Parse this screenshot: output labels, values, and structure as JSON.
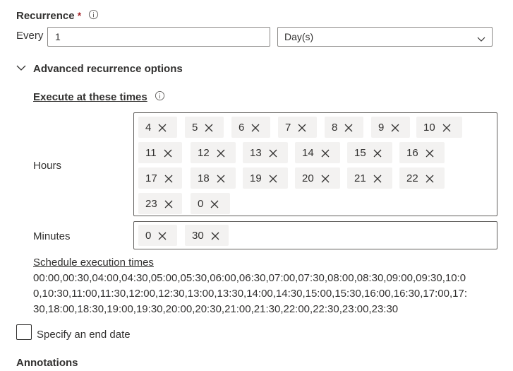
{
  "recurrence": {
    "label": "Recurrence",
    "required_mark": "*",
    "every_label": "Every",
    "every_value": "1",
    "unit_selected": "Day(s)"
  },
  "advanced": {
    "toggle_label": "Advanced recurrence options",
    "execute_label": "Execute at these times",
    "hours_label": "Hours",
    "hours": [
      "4",
      "5",
      "6",
      "7",
      "8",
      "9",
      "10",
      "11",
      "12",
      "13",
      "14",
      "15",
      "16",
      "17",
      "18",
      "19",
      "20",
      "21",
      "22",
      "23",
      "0"
    ],
    "minutes_label": "Minutes",
    "minutes": [
      "0",
      "30"
    ],
    "schedule_label": "Schedule execution times",
    "schedule_lines": [
      "00:00,00:30,04:00,04:30,05:00,05:30,06:00,06:30,07:00,07:30,08:00,08:30,09:00,09:30,10:0",
      "0,10:30,11:00,11:30,12:00,12:30,13:00,13:30,14:00,14:30,15:00,15:30,16:00,16:30,17:00,17:",
      "30,18:00,18:30,19:00,19:30,20:00,20:30,21:00,21:30,22:00,22:30,23:00,23:30"
    ]
  },
  "end_date": {
    "label": "Specify an end date",
    "checked": false
  },
  "annotations": {
    "label": "Annotations"
  },
  "icons": {
    "info": "info-icon",
    "chevron": "chevron-down-icon",
    "remove": "close-icon"
  },
  "colors": {
    "required": "#a4262c",
    "text": "#323130",
    "border": "#8a8886",
    "tag_bg": "#f3f2f1"
  }
}
